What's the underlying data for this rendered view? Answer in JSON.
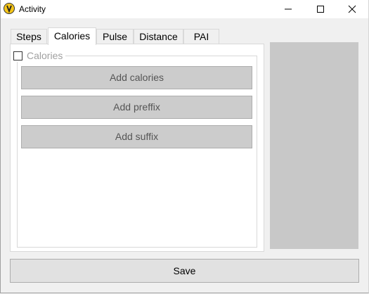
{
  "window": {
    "title": "Activity"
  },
  "tabs": [
    {
      "label": "Steps",
      "active": false
    },
    {
      "label": "Calories",
      "active": true
    },
    {
      "label": "Pulse",
      "active": false
    },
    {
      "label": "Distance",
      "active": false
    },
    {
      "label": "PAI",
      "active": false
    }
  ],
  "calories_group": {
    "checkbox_label": "Calories",
    "checked": false,
    "buttons": [
      {
        "label": "Add calories"
      },
      {
        "label": "Add preffix"
      },
      {
        "label": "Add suffix"
      }
    ]
  },
  "footer": {
    "save_label": "Save"
  },
  "icons": {
    "app": "app-logo-icon",
    "minimize": "minimize-icon",
    "maximize": "maximize-icon",
    "close": "close-icon"
  },
  "colors": {
    "accent_icon": "#f5c518",
    "panel_gray": "#c8c8c8",
    "button_gray": "#cccccc"
  }
}
